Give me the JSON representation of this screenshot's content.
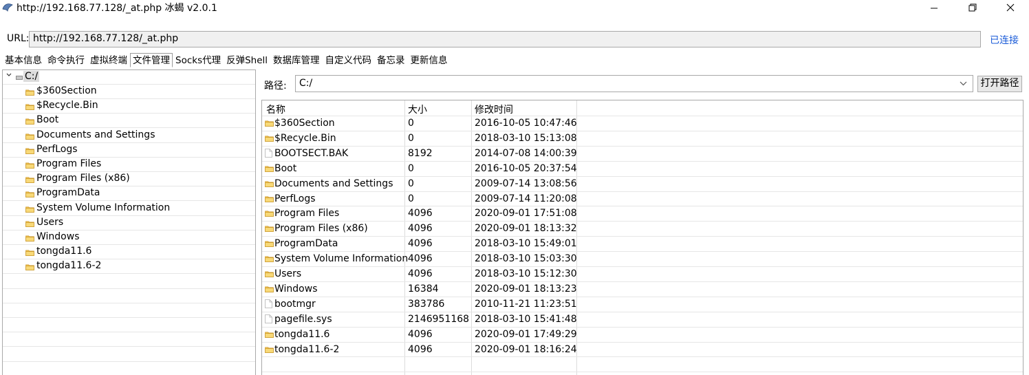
{
  "window": {
    "title": "http://192.168.77.128/_at.php    冰蝎 v2.0.1",
    "minimize_glyph": "—",
    "maximize_glyph": "❐",
    "close_glyph": "✕"
  },
  "url_bar": {
    "label": "URL:",
    "value": "http://192.168.77.128/_at.php",
    "status": "已连接"
  },
  "tabs": [
    {
      "label": "基本信息",
      "active": false
    },
    {
      "label": "命令执行",
      "active": false
    },
    {
      "label": "虚拟终端",
      "active": false
    },
    {
      "label": "文件管理",
      "active": true
    },
    {
      "label": "Socks代理",
      "active": false
    },
    {
      "label": "反弹Shell",
      "active": false
    },
    {
      "label": "数据库管理",
      "active": false
    },
    {
      "label": "自定义代码",
      "active": false
    },
    {
      "label": "备忘录",
      "active": false
    },
    {
      "label": "更新信息",
      "active": false
    }
  ],
  "tree": {
    "root": {
      "label": "C:/",
      "expanded": true,
      "icon": "drive-icon"
    },
    "children": [
      {
        "label": "$360Section",
        "icon": "folder-icon"
      },
      {
        "label": "$Recycle.Bin",
        "icon": "folder-icon"
      },
      {
        "label": "Boot",
        "icon": "folder-icon"
      },
      {
        "label": "Documents and Settings",
        "icon": "folder-icon"
      },
      {
        "label": "PerfLogs",
        "icon": "folder-icon"
      },
      {
        "label": "Program Files",
        "icon": "folder-icon"
      },
      {
        "label": "Program Files (x86)",
        "icon": "folder-icon"
      },
      {
        "label": "ProgramData",
        "icon": "folder-icon"
      },
      {
        "label": "System Volume Information",
        "icon": "folder-icon"
      },
      {
        "label": "Users",
        "icon": "folder-icon"
      },
      {
        "label": "Windows",
        "icon": "folder-icon"
      },
      {
        "label": "tongda11.6",
        "icon": "folder-icon"
      },
      {
        "label": "tongda11.6-2",
        "icon": "folder-icon"
      }
    ]
  },
  "path_bar": {
    "label": "路径:",
    "value": "C:/",
    "open_button": "打开路径"
  },
  "file_table": {
    "columns": [
      "名称",
      "大小",
      "修改时间"
    ],
    "rows": [
      {
        "name": "$360Section",
        "size": "0",
        "mtime": "2016-10-05 10:47:46",
        "type": "folder"
      },
      {
        "name": "$Recycle.Bin",
        "size": "0",
        "mtime": "2018-03-10 15:13:08",
        "type": "folder"
      },
      {
        "name": "BOOTSECT.BAK",
        "size": "8192",
        "mtime": "2014-07-08 14:00:39",
        "type": "file"
      },
      {
        "name": "Boot",
        "size": "0",
        "mtime": "2016-10-05 20:37:54",
        "type": "folder"
      },
      {
        "name": "Documents and Settings",
        "size": "0",
        "mtime": "2009-07-14 13:08:56",
        "type": "folder"
      },
      {
        "name": "PerfLogs",
        "size": "0",
        "mtime": "2009-07-14 11:20:08",
        "type": "folder"
      },
      {
        "name": "Program Files",
        "size": "4096",
        "mtime": "2020-09-01 17:51:08",
        "type": "folder"
      },
      {
        "name": "Program Files (x86)",
        "size": "4096",
        "mtime": "2020-09-01 18:13:32",
        "type": "folder"
      },
      {
        "name": "ProgramData",
        "size": "4096",
        "mtime": "2018-03-10 15:49:01",
        "type": "folder"
      },
      {
        "name": "System Volume Information",
        "size": "4096",
        "mtime": "2018-03-10 15:03:30",
        "type": "folder"
      },
      {
        "name": "Users",
        "size": "4096",
        "mtime": "2018-03-10 15:12:30",
        "type": "folder"
      },
      {
        "name": "Windows",
        "size": "16384",
        "mtime": "2020-09-01 18:13:23",
        "type": "folder"
      },
      {
        "name": "bootmgr",
        "size": "383786",
        "mtime": "2010-11-21 11:23:51",
        "type": "file"
      },
      {
        "name": "pagefile.sys",
        "size": "2146951168",
        "mtime": "2018-03-10 15:41:48",
        "type": "file"
      },
      {
        "name": "tongda11.6",
        "size": "4096",
        "mtime": "2020-09-01 17:49:29",
        "type": "folder"
      },
      {
        "name": "tongda11.6-2",
        "size": "4096",
        "mtime": "2020-09-01 18:16:24",
        "type": "folder"
      }
    ]
  },
  "colors": {
    "accent_link": "#1a5bd8",
    "folder": "#f2c44e",
    "selection": "#dcdcdc"
  }
}
